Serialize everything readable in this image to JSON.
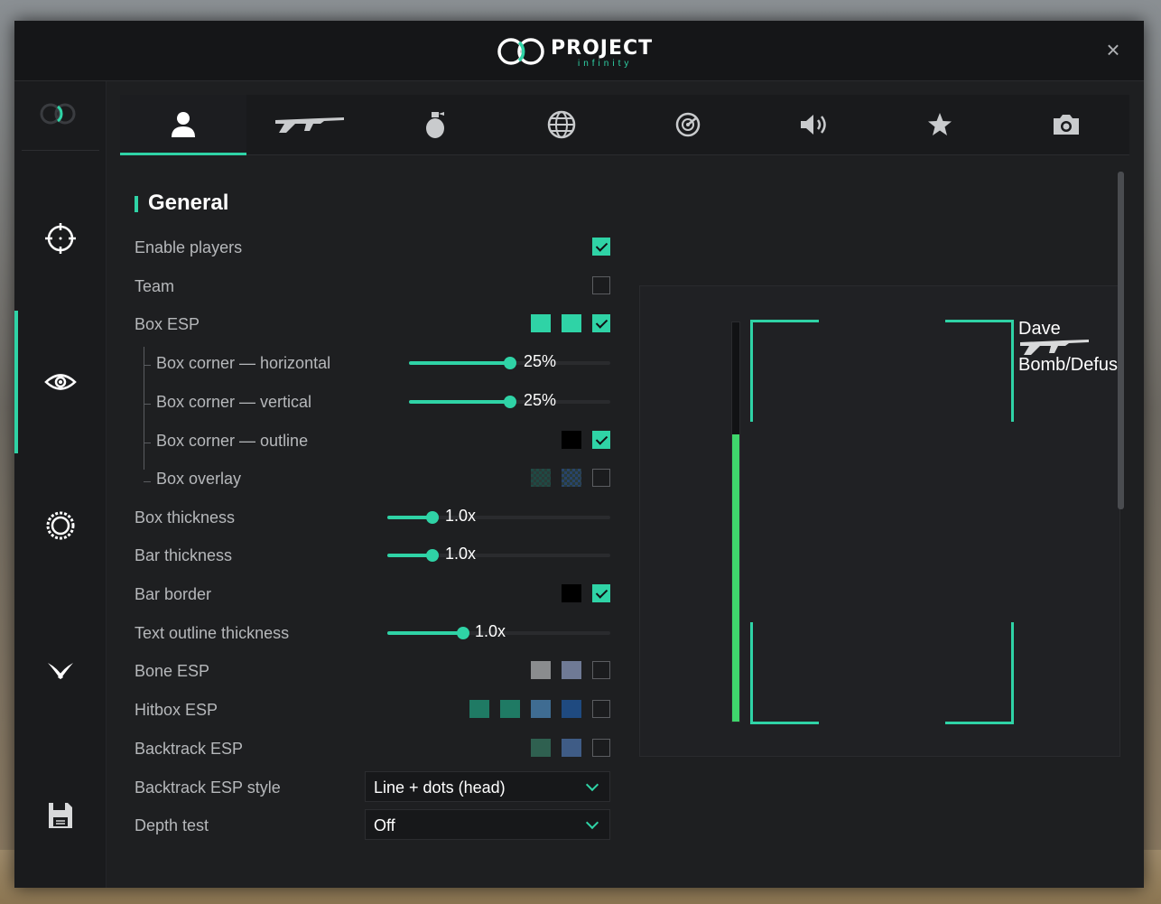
{
  "app": {
    "logo_word": "PROJECT",
    "logo_sub": "infinity",
    "close_label": "×"
  },
  "sidebar": {
    "items": [
      {
        "name": "aimbot",
        "icon": "crosshair-icon"
      },
      {
        "name": "visuals",
        "icon": "eye-icon",
        "active": true
      },
      {
        "name": "misc",
        "icon": "gear-icon"
      },
      {
        "name": "skins",
        "icon": "knife-icon"
      },
      {
        "name": "config",
        "icon": "floppy-disk-icon"
      }
    ]
  },
  "tabs": [
    {
      "name": "players",
      "icon": "person-icon",
      "active": true
    },
    {
      "name": "weapons",
      "icon": "rifle-icon"
    },
    {
      "name": "grenades",
      "icon": "grenade-icon"
    },
    {
      "name": "world",
      "icon": "globe-icon"
    },
    {
      "name": "radar",
      "icon": "radar-icon"
    },
    {
      "name": "sounds",
      "icon": "speaker-icon"
    },
    {
      "name": "glow",
      "icon": "star-icon"
    },
    {
      "name": "camera",
      "icon": "camera-icon"
    }
  ],
  "section": {
    "title": "General"
  },
  "settings": {
    "enable_players": {
      "label": "Enable players",
      "checked": true
    },
    "team": {
      "label": "Team",
      "checked": false
    },
    "box_esp": {
      "label": "Box ESP",
      "checked": true,
      "colors": [
        "#2fd3a6",
        "#2fd3a6"
      ]
    },
    "box_corner_h": {
      "label": "Box corner — horizontal",
      "value": "25%",
      "fraction": 0.25
    },
    "box_corner_v": {
      "label": "Box corner — vertical",
      "value": "25%",
      "fraction": 0.25
    },
    "box_corner_outline": {
      "label": "Box corner — outline",
      "checked": true,
      "colors": [
        "#000000"
      ]
    },
    "box_overlay": {
      "label": "Box overlay",
      "checked": false
    },
    "box_thickness": {
      "label": "Box thickness",
      "value": "1.0x"
    },
    "bar_thickness": {
      "label": "Bar thickness",
      "value": "1.0x"
    },
    "bar_border": {
      "label": "Bar border",
      "checked": true,
      "colors": [
        "#000000"
      ]
    },
    "text_outline": {
      "label": "Text outline thickness",
      "value": "1.0x"
    },
    "bone_esp": {
      "label": "Bone ESP",
      "checked": false,
      "colors": [
        "#8a8c8e",
        "#6f7a95"
      ]
    },
    "hitbox_esp": {
      "label": "Hitbox ESP",
      "checked": false,
      "colors": [
        "#1f7a64",
        "#1f7a64",
        "#3f6c92",
        "#1f4a80"
      ]
    },
    "backtrack_esp": {
      "label": "Backtrack ESP",
      "checked": false,
      "colors": [
        "#2f6050",
        "#3f5c86"
      ]
    },
    "backtrack_style": {
      "label": "Backtrack ESP style",
      "value": "Line + dots (head)"
    },
    "depth_test": {
      "label": "Depth test",
      "value": "Off"
    }
  },
  "preview": {
    "player_name": "Dave",
    "weapon_text": "Bomb/Defus",
    "health_fraction": 0.72,
    "box_color": "#2fd3a6",
    "health_color": "#3fd66c"
  },
  "colors": {
    "accent": "#2fd3a6",
    "panel": "#1e1f21"
  }
}
